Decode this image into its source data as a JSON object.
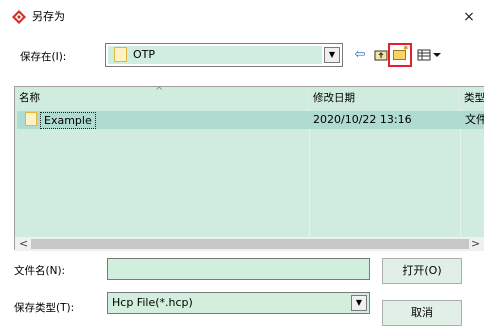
{
  "window": {
    "title": "另存为",
    "close_glyph": "×"
  },
  "lookin": {
    "label": "保存在(I):",
    "value": "OTP"
  },
  "toolbar": {
    "back_icon": "back-arrow-icon",
    "up_icon": "up-folder-icon",
    "new_folder_icon": "new-folder-icon",
    "view_icon": "view-menu-icon"
  },
  "list": {
    "columns": [
      "名称",
      "修改日期",
      "类型"
    ],
    "rows": [
      {
        "name": "Example",
        "date": "2020/10/22 13:16",
        "type": "文件夹"
      }
    ]
  },
  "form": {
    "filename_label": "文件名(N):",
    "filename_value": "",
    "filetype_label": "保存类型(T):",
    "filetype_value": "Hcp File(*.hcp)"
  },
  "buttons": {
    "open": "打开(O)",
    "cancel": "取消"
  },
  "colors": {
    "selection": "#b0dbd0",
    "list_bg": "#d0ecde",
    "highlight_border": "#e0202a"
  }
}
